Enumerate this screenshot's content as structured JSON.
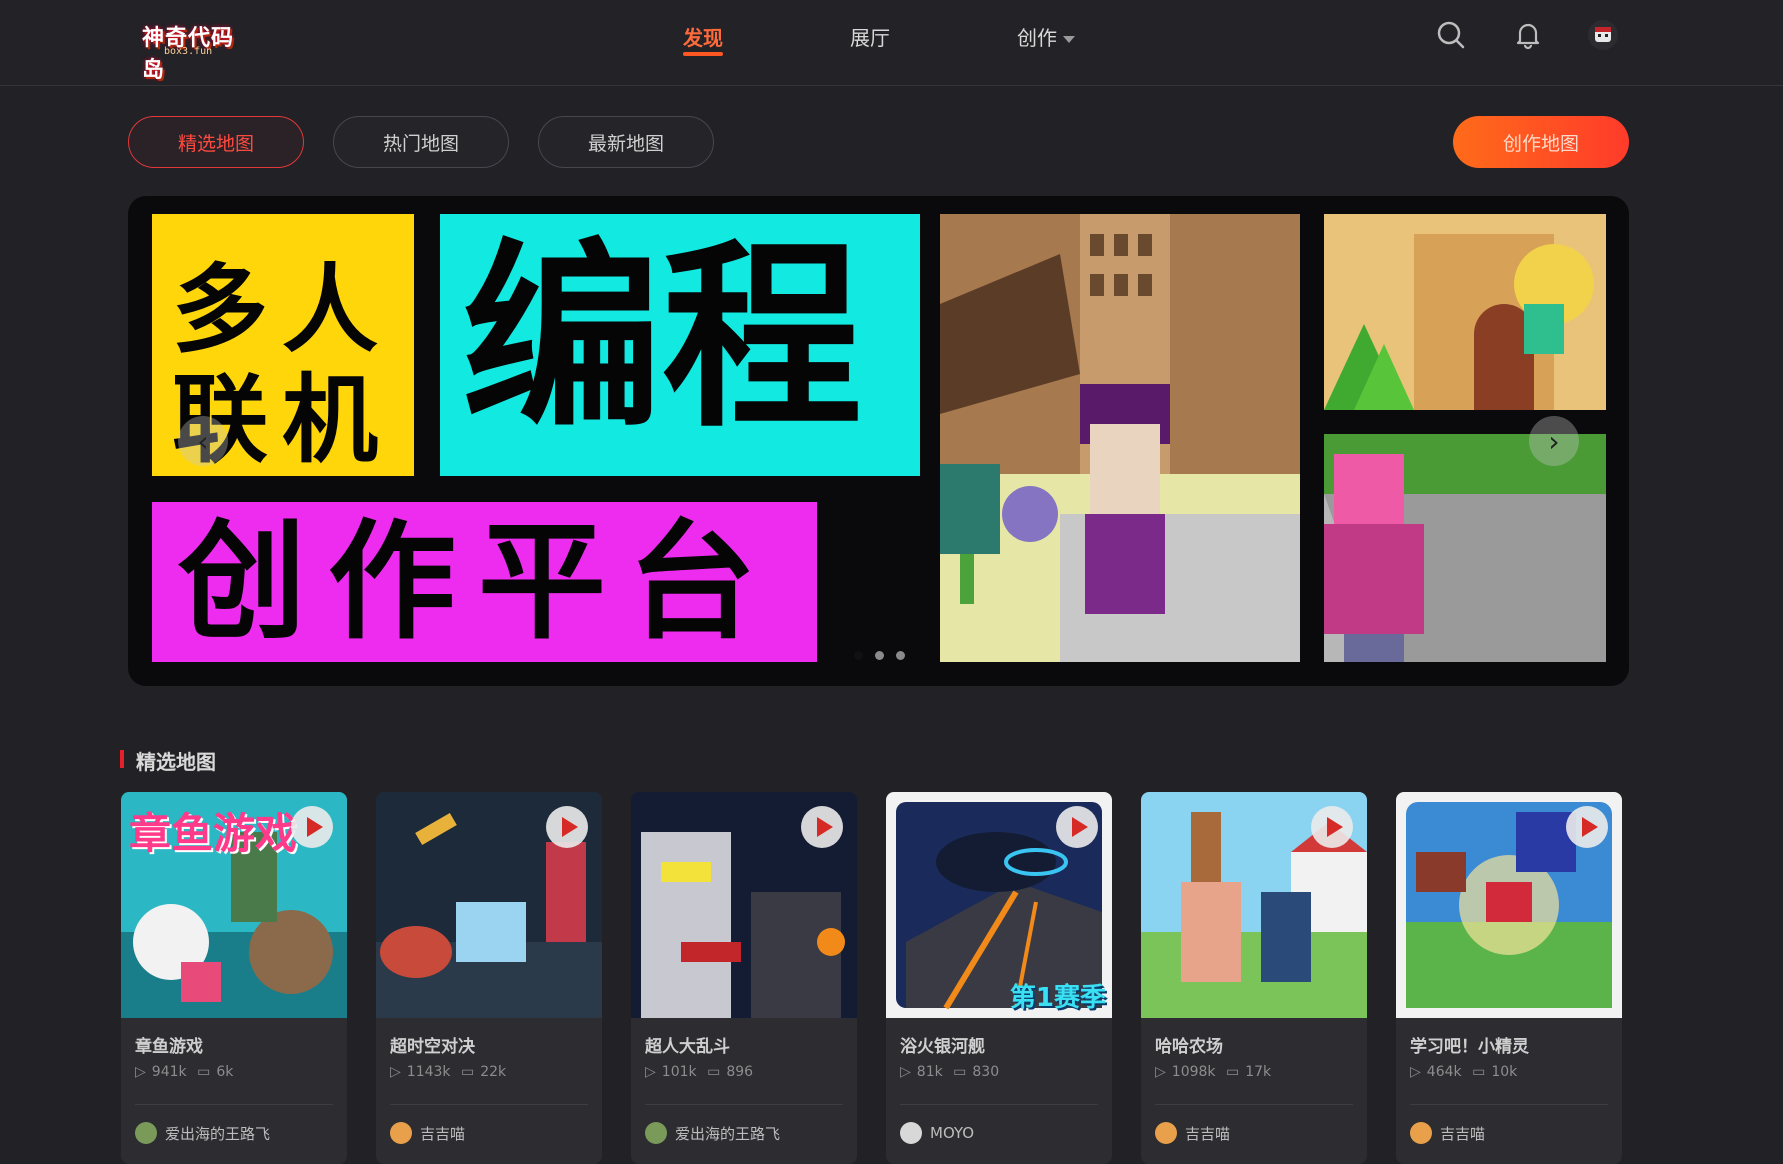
{
  "header": {
    "logo_text": "神奇代码岛",
    "logo_sub": "box3.fun",
    "nav": [
      {
        "label": "发现"
      },
      {
        "label": "展厅"
      },
      {
        "label": "创作"
      }
    ]
  },
  "tabs": [
    "精选地图",
    "热门地图",
    "最新地图"
  ],
  "create_button": "创作地图",
  "banner": {
    "line1": "多人",
    "line2": "联机",
    "big": "编程",
    "bottom": "创作平台",
    "dots": 3,
    "active_dot": 1
  },
  "section_title": "精选地图",
  "cards": [
    {
      "title": "章鱼游戏",
      "plays": "941k",
      "comments": "6k",
      "author": "爱出海的王路飞"
    },
    {
      "title": "超时空对决",
      "plays": "1143k",
      "comments": "22k",
      "author": "吉吉喵"
    },
    {
      "title": "超人大乱斗",
      "plays": "101k",
      "comments": "896",
      "author": "爱出海的王路飞"
    },
    {
      "title": "浴火银河舰",
      "plays": "81k",
      "comments": "830",
      "author": "MOYO",
      "badge": "第1赛季"
    },
    {
      "title": "哈哈农场",
      "plays": "1098k",
      "comments": "17k",
      "author": "吉吉喵"
    },
    {
      "title": "学习吧！小精灵",
      "plays": "464k",
      "comments": "10k",
      "author": "吉吉喵"
    }
  ],
  "thumb_text": {
    "card1": "章鱼游戏"
  },
  "colors": {
    "accent": "#ff5722",
    "bg": "#212126",
    "card": "#2c2c31"
  }
}
